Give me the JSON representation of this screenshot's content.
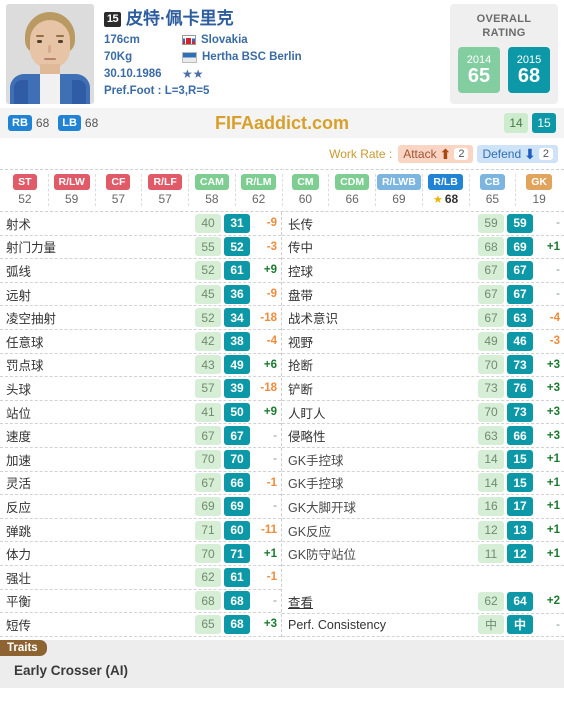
{
  "player": {
    "jersey": "15",
    "name": "皮特·佩卡里克",
    "height": "176cm",
    "weight": "70Kg",
    "birthdate": "30.10.1986",
    "nation": "Slovakia",
    "club": "Hertha BSC Berlin",
    "skill_stars": "★★",
    "pref_foot": "Pref.Foot : L=3,R=5"
  },
  "rating": {
    "title_line1": "OVERALL",
    "title_line2": "RATING",
    "old_year": "2014",
    "old_value": "65",
    "new_year": "2015",
    "new_value": "68",
    "old_color": "#82cea0",
    "new_color": "#0d98a8"
  },
  "brandbar": {
    "mini_positions": [
      {
        "tag": "RB",
        "value": "68"
      },
      {
        "tag": "LB",
        "value": "68"
      }
    ],
    "brand": "FIFAaddict.com",
    "year_old": "14",
    "year_new": "15"
  },
  "workrate": {
    "label": "Work Rate :",
    "attack_label": "Attack",
    "attack_value": "2",
    "attack_icon": "arrow-up-icon",
    "defend_label": "Defend",
    "defend_value": "2",
    "defend_icon": "arrow-down-icon"
  },
  "positions": [
    {
      "tag": "ST",
      "value": "52",
      "color": "red",
      "best": false
    },
    {
      "tag": "R/LW",
      "value": "59",
      "color": "red",
      "best": false
    },
    {
      "tag": "CF",
      "value": "57",
      "color": "red",
      "best": false
    },
    {
      "tag": "R/LF",
      "value": "57",
      "color": "red",
      "best": false
    },
    {
      "tag": "CAM",
      "value": "58",
      "color": "grn",
      "best": false
    },
    {
      "tag": "R/LM",
      "value": "62",
      "color": "grn",
      "best": false
    },
    {
      "tag": "CM",
      "value": "60",
      "color": "grn",
      "best": false
    },
    {
      "tag": "CDM",
      "value": "66",
      "color": "grn",
      "best": false
    },
    {
      "tag": "R/LWB",
      "value": "69",
      "color": "blu",
      "best": false
    },
    {
      "tag": "R/LB",
      "value": "68",
      "color": "dblu",
      "best": true
    },
    {
      "tag": "CB",
      "value": "65",
      "color": "blu",
      "best": false
    },
    {
      "tag": "GK",
      "value": "19",
      "color": "org",
      "best": false
    }
  ],
  "stats_left": [
    {
      "name": "射术",
      "old": "40",
      "new": "31",
      "delta": "-9"
    },
    {
      "name": "射门力量",
      "old": "55",
      "new": "52",
      "delta": "-3"
    },
    {
      "name": "弧线",
      "old": "52",
      "new": "61",
      "delta": "+9"
    },
    {
      "name": "远射",
      "old": "45",
      "new": "36",
      "delta": "-9"
    },
    {
      "name": "凌空抽射",
      "old": "52",
      "new": "34",
      "delta": "-18"
    },
    {
      "name": "任意球",
      "old": "42",
      "new": "38",
      "delta": "-4"
    },
    {
      "name": "罚点球",
      "old": "43",
      "new": "49",
      "delta": "+6"
    },
    {
      "name": "头球",
      "old": "57",
      "new": "39",
      "delta": "-18"
    },
    {
      "name": "站位",
      "old": "41",
      "new": "50",
      "delta": "+9"
    },
    {
      "name": "速度",
      "old": "67",
      "new": "67",
      "delta": "-"
    },
    {
      "name": "加速",
      "old": "70",
      "new": "70",
      "delta": "-"
    },
    {
      "name": "灵活",
      "old": "67",
      "new": "66",
      "delta": "-1"
    },
    {
      "name": "反应",
      "old": "69",
      "new": "69",
      "delta": "-"
    },
    {
      "name": "弹跳",
      "old": "71",
      "new": "60",
      "delta": "-11"
    },
    {
      "name": "体力",
      "old": "70",
      "new": "71",
      "delta": "+1"
    },
    {
      "name": "强壮",
      "old": "62",
      "new": "61",
      "delta": "-1"
    },
    {
      "name": "平衡",
      "old": "68",
      "new": "68",
      "delta": "-"
    },
    {
      "name": "短传",
      "old": "65",
      "new": "68",
      "delta": "+3"
    }
  ],
  "stats_right": [
    {
      "name": "长传",
      "old": "59",
      "new": "59",
      "delta": "-"
    },
    {
      "name": "传中",
      "old": "68",
      "new": "69",
      "delta": "+1"
    },
    {
      "name": "控球",
      "old": "67",
      "new": "67",
      "delta": "-"
    },
    {
      "name": "盘带",
      "old": "67",
      "new": "67",
      "delta": "-"
    },
    {
      "name": "战术意识",
      "old": "67",
      "new": "63",
      "delta": "-4"
    },
    {
      "name": "视野",
      "old": "49",
      "new": "46",
      "delta": "-3"
    },
    {
      "name": "抢断",
      "old": "70",
      "new": "73",
      "delta": "+3"
    },
    {
      "name": "铲断",
      "old": "73",
      "new": "76",
      "delta": "+3"
    },
    {
      "name": "人盯人",
      "old": "70",
      "new": "73",
      "delta": "+3"
    },
    {
      "name": "侵略性",
      "old": "63",
      "new": "66",
      "delta": "+3"
    },
    {
      "name": "GK手控球",
      "old": "14",
      "new": "15",
      "delta": "+1"
    },
    {
      "name": "GK手控球",
      "old": "14",
      "new": "15",
      "delta": "+1"
    },
    {
      "name": "GK大脚开球",
      "old": "16",
      "new": "17",
      "delta": "+1"
    },
    {
      "name": "GK反应",
      "old": "12",
      "new": "13",
      "delta": "+1"
    },
    {
      "name": "GK防守站位",
      "old": "11",
      "new": "12",
      "delta": "+1"
    },
    {
      "name": "",
      "old": "",
      "new": "",
      "delta": "",
      "spacer": true
    },
    {
      "name": "查看",
      "old": "62",
      "new": "64",
      "delta": "+2",
      "link": true
    },
    {
      "name": "Perf. Consistency",
      "old": "中",
      "new": "中",
      "delta": "-"
    }
  ],
  "traits": {
    "label": "Traits",
    "items": [
      "Early Crosser (AI)"
    ]
  }
}
